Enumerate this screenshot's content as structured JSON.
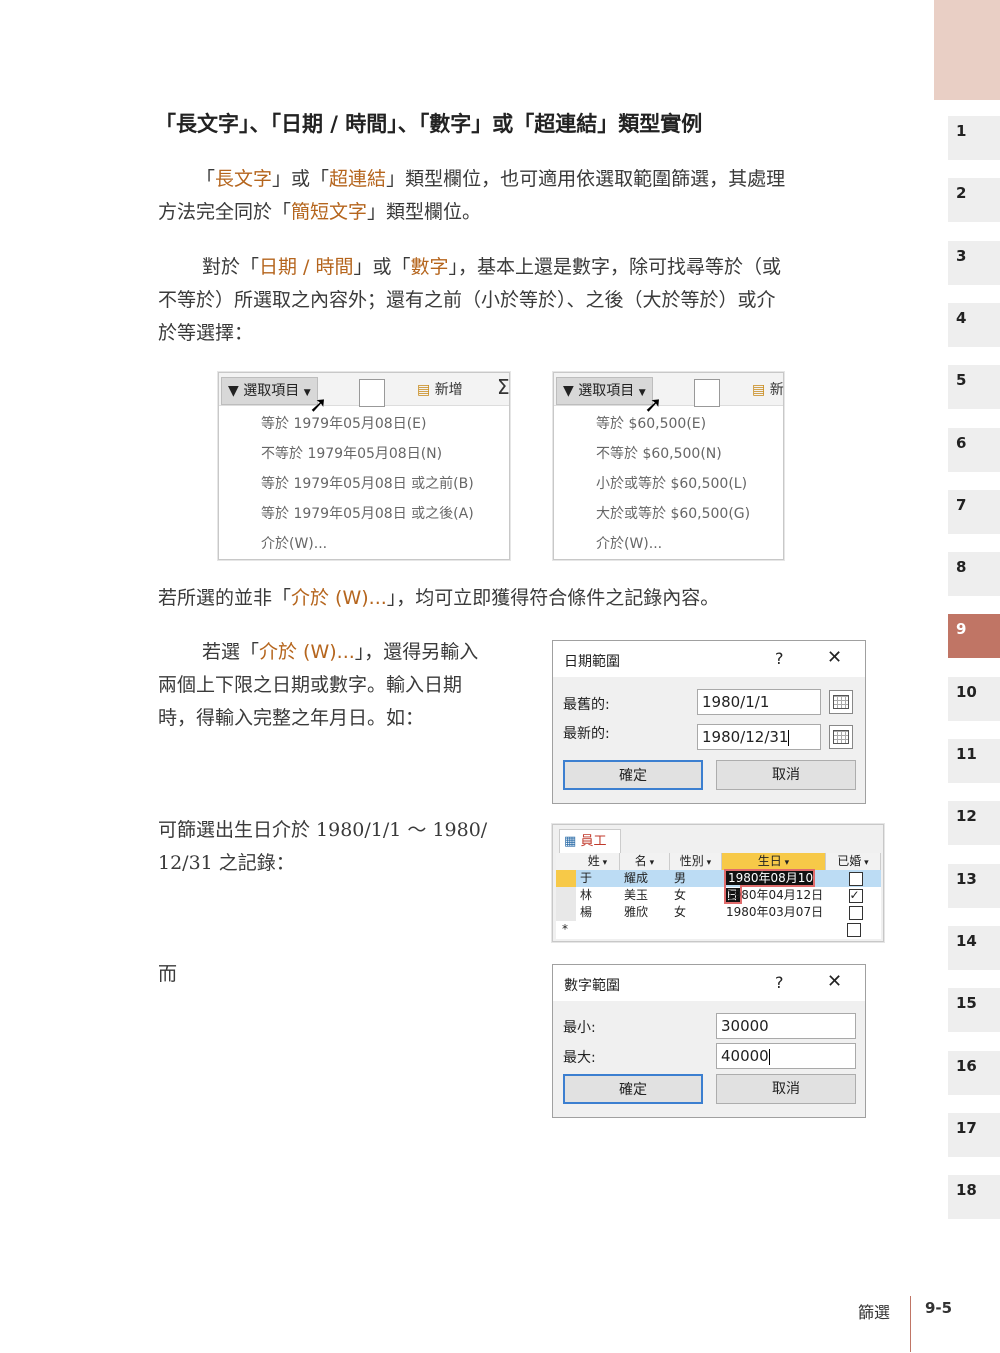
{
  "heading": "「長文字」、「日期 / 時間」、「數字」或「超連結」類型實例",
  "p1": {
    "pre": "「",
    "t1": "長文字",
    "mid1": "」或「",
    "t2": "超連結",
    "mid2": "」類型欄位，也可適用依選取範圍篩選，其處理",
    "line2_pre": "方法完全同於「",
    "t3": "簡短文字",
    "line2_post": "」類型欄位。"
  },
  "p2": {
    "pre": "對於「",
    "t1": "日期 / 時間",
    "mid": "」或「",
    "t2": "數字",
    "post": "」，基本上還是數字，除可找尋等於（或",
    "line2": "不等於）所選取之內容外；還有之前（小於等於）、之後（大於等於）或介",
    "line3": "於等選擇："
  },
  "date_menu": {
    "button": "選取項目",
    "new_label": "新增",
    "items": [
      "等於 1979年05月08日(E)",
      "不等於 1979年05月08日(N)",
      "等於 1979年05月08日 或之前(B)",
      "等於 1979年05月08日 或之後(A)",
      "介於(W)..."
    ]
  },
  "num_menu": {
    "button": "選取項目",
    "new_label": "新",
    "items": [
      "等於 $60,500(E)",
      "不等於 $60,500(N)",
      "小於或等於 $60,500(L)",
      "大於或等於 $60,500(G)",
      "介於(W)..."
    ]
  },
  "p3": {
    "pre": "若所選的並非「",
    "t1": "介於 (W)...",
    "post": "」，均可立即獲得符合條件之記錄內容。"
  },
  "p4": {
    "pre": "若選「",
    "t1": "介於 (W)...",
    "post": "」，還得另輸入",
    "line2": "兩個上下限之日期或數字。輸入日期",
    "line3": "時，得輸入完整之年月日。如："
  },
  "date_dialog": {
    "title": "日期範圍",
    "help": "?",
    "close": "✕",
    "oldest_label": "最舊的:",
    "oldest_value": "1980/1/1",
    "newest_label": "最新的:",
    "newest_value": "1980/12/31",
    "ok": "確定",
    "cancel": "取消"
  },
  "p5": {
    "line1": "可篩選出生日介於 1980/1/1 ～ 1980/",
    "line2": "12/31 之記錄："
  },
  "table": {
    "tab": "員工",
    "headers": [
      "姓",
      "名",
      "性別",
      "生日",
      "已婚"
    ],
    "rows": [
      {
        "last": "于",
        "first": "耀成",
        "gender": "男",
        "birth": "1980年08月10日",
        "married": false
      },
      {
        "last": "林",
        "first": "美玉",
        "gender": "女",
        "birth": "1980年04月12日",
        "married": true
      },
      {
        "last": "楊",
        "first": "雅欣",
        "gender": "女",
        "birth": "1980年03月07日",
        "married": false
      }
    ],
    "new_row_marker": "*"
  },
  "p6": "而",
  "num_dialog": {
    "title": "數字範圍",
    "help": "?",
    "close": "✕",
    "min_label": "最小:",
    "min_value": "30000",
    "max_label": "最大:",
    "max_value": "40000",
    "ok": "確定",
    "cancel": "取消"
  },
  "chapter_tabs": [
    "1",
    "2",
    "3",
    "4",
    "5",
    "6",
    "7",
    "8",
    "9",
    "10",
    "11",
    "12",
    "13",
    "14",
    "15",
    "16",
    "17",
    "18"
  ],
  "active_chapter": "9",
  "footer": {
    "section": "篩選",
    "page": "9-5"
  },
  "colors": {
    "highlight": "#b5651d",
    "active_tab": "#c07565",
    "tab_top": "#e9cfc5"
  }
}
